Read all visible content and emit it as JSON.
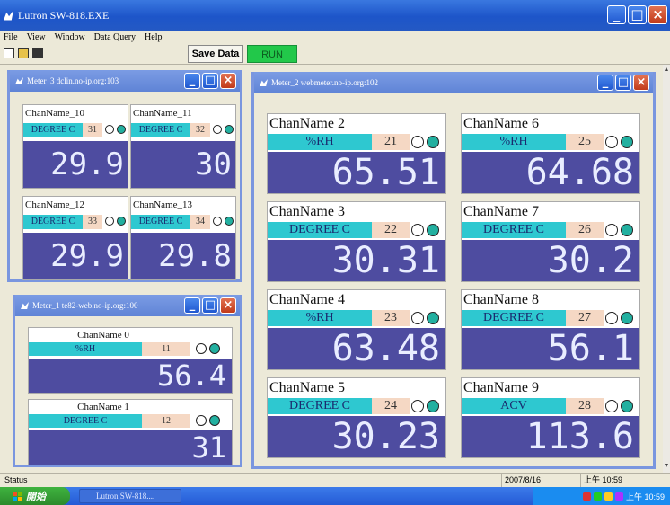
{
  "app": {
    "title": "Lutron SW-818.EXE"
  },
  "menu": [
    "File",
    "View",
    "Window",
    "Data Query",
    "Help"
  ],
  "toolbar": {
    "save_label": "Save Data",
    "run_label": "RUN"
  },
  "windows": [
    {
      "title": "Meter_3  dclin.no-ip.org:103",
      "meters": [
        {
          "name": "ChanName_10",
          "unit": "DEGREE C",
          "num": "31",
          "value": "29.9"
        },
        {
          "name": "ChanName_11",
          "unit": "DEGREE C",
          "num": "32",
          "value": "30"
        },
        {
          "name": "ChanName_12",
          "unit": "DEGREE C",
          "num": "33",
          "value": "29.9"
        },
        {
          "name": "ChanName_13",
          "unit": "DEGREE C",
          "num": "34",
          "value": "29.8"
        }
      ]
    },
    {
      "title": "Meter_1  te82-web.no-ip.org:100",
      "meters": [
        {
          "name": "ChanName  0",
          "unit": "%RH",
          "num": "11",
          "value": "56.4"
        },
        {
          "name": "ChanName  1",
          "unit": "DEGREE C",
          "num": "12",
          "value": "31"
        }
      ]
    },
    {
      "title": "Meter_2  webmeter.no-ip.org:102",
      "meters": [
        {
          "name": "ChanName  2",
          "unit": "%RH",
          "num": "21",
          "value": "65.51"
        },
        {
          "name": "ChanName  6",
          "unit": "%RH",
          "num": "25",
          "value": "64.68"
        },
        {
          "name": "ChanName  3",
          "unit": "DEGREE C",
          "num": "22",
          "value": "30.31"
        },
        {
          "name": "ChanName  7",
          "unit": "DEGREE C",
          "num": "26",
          "value": "30.2"
        },
        {
          "name": "ChanName  4",
          "unit": "%RH",
          "num": "23",
          "value": "63.48"
        },
        {
          "name": "ChanName  8",
          "unit": "DEGREE C",
          "num": "27",
          "value": "56.1"
        },
        {
          "name": "ChanName  5",
          "unit": "DEGREE C",
          "num": "24",
          "value": "30.23"
        },
        {
          "name": "ChanName  9",
          "unit": "ACV",
          "num": "28",
          "value": "113.6"
        }
      ]
    }
  ],
  "status": {
    "text": "Status",
    "date": "2007/8/16",
    "time": "上午 10:59"
  },
  "taskbar": {
    "start": "開始",
    "task": "Lutron SW-818....",
    "clock": "上午 10:59"
  },
  "colors": {
    "unit_bg": "#2ec8d0",
    "display_bg": "#4e4ca0",
    "num_bg": "#f5d8c4",
    "title_bar": "#245ad6",
    "run_button": "#22c84a"
  },
  "icons": {
    "window_controls": [
      "minimize-icon",
      "maximize-icon",
      "close-icon"
    ],
    "toolbar": [
      "new-file-icon",
      "open-folder-icon",
      "save-disk-icon"
    ]
  }
}
